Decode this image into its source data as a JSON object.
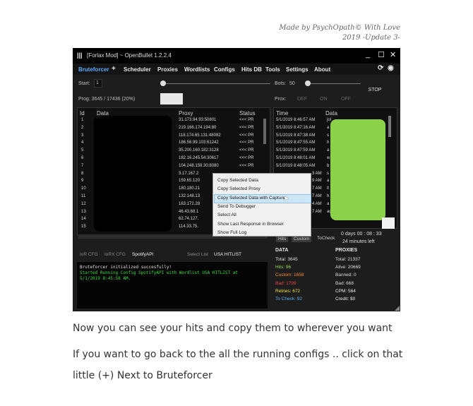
{
  "credit": {
    "line1": "Made by PsychOpath© With Love",
    "line2": "2019 -Update 3-"
  },
  "window": {
    "title": "[Forlax Mod] ~ OpenBullet 1.2.2.4",
    "controls": {
      "minimize": "_",
      "maximize": "☐",
      "close": "✕"
    }
  },
  "menu": {
    "items": [
      "Bruteforcer",
      "+",
      "Scheduler",
      "Proxies",
      "Wordlists",
      "Configs",
      "Hits DB",
      "Tools",
      "Settings",
      "About"
    ],
    "active": "Bruteforcer"
  },
  "controls": {
    "start_label": "Start:",
    "start_value": "1",
    "bots_label": "Bots:",
    "bots_value": "50",
    "stop_button": "STOP",
    "prog_label": "Prog: 3645 / 17436 (20%)",
    "prox_label": "Prox:",
    "prox_options": [
      "DEF",
      "ON",
      "OFF"
    ]
  },
  "grid_left": {
    "headers": [
      "Id",
      "Data",
      "Proxy",
      "Status"
    ],
    "rows": [
      {
        "id": "1",
        "proxy": "31.173.94.93:50801",
        "status": "<<< PR"
      },
      {
        "id": "2",
        "proxy": "219.166.174.194:80",
        "status": "<<< PR"
      },
      {
        "id": "3",
        "proxy": "118.174.65.131:48082",
        "status": "<<< PR"
      },
      {
        "id": "4",
        "proxy": "186.56.99.103:61242",
        "status": "<<< PR"
      },
      {
        "id": "5",
        "proxy": "35.200.160.182:3128",
        "status": "<<< PR"
      },
      {
        "id": "6",
        "proxy": "182.16.245.54:30617",
        "status": "<<< PR"
      },
      {
        "id": "7",
        "proxy": "104.248.159.30:8080",
        "status": "<<< PR"
      },
      {
        "id": "8",
        "proxy": "3.17.167.2",
        "status": ""
      },
      {
        "id": "9",
        "proxy": "159.65.120",
        "status": ""
      },
      {
        "id": "10",
        "proxy": "180.180.21",
        "status": ""
      },
      {
        "id": "11",
        "proxy": "132.148.13",
        "status": ""
      },
      {
        "id": "12",
        "proxy": "163.172.28",
        "status": ""
      },
      {
        "id": "13",
        "proxy": "46.43.68.1",
        "status": ""
      },
      {
        "id": "14",
        "proxy": "62.74.127.",
        "status": ""
      },
      {
        "id": "15",
        "proxy": "114.33.75.",
        "status": ""
      }
    ]
  },
  "grid_right": {
    "headers": [
      "Time",
      "Data"
    ],
    "rows": [
      {
        "time": "5/1/2019 8:46:57 AM",
        "data": "jol"
      },
      {
        "time": "5/1/2019 8:47:16 AM",
        "data": "a"
      },
      {
        "time": "5/1/2019 8:47:38 AM",
        "data": "s"
      },
      {
        "time": "5/1/2019 8:47:55 AM",
        "data": "h"
      },
      {
        "time": "5/1/2019 8:47:59 AM",
        "data": "a"
      },
      {
        "time": "5/1/2019 8:48:01 AM",
        "data": "w"
      },
      {
        "time": "5/1/2019 8:48:05 AM",
        "data": "b"
      },
      {
        "time": "3 AM",
        "data": "s"
      },
      {
        "time": "9 AM",
        "data": "a"
      },
      {
        "time": "7 AM",
        "data": "lt"
      },
      {
        "time": "7 AM",
        "data": "h"
      },
      {
        "time": "4 AM",
        "data": "a"
      },
      {
        "time": "7 AM",
        "data": "ad"
      }
    ]
  },
  "context_menu": {
    "items": [
      "Copy Selected Data",
      "Copy Selected Proxy",
      "Copy Selected Data with Capture",
      "Send To Debugger",
      "Select All",
      "Show Last Response in Browser",
      "Show Full Log"
    ],
    "highlighted_index": 2
  },
  "result_tabs": [
    "Hits",
    "Custom",
    "ToCheck"
  ],
  "timer": {
    "line1": "0 days 00 : 08 : 33",
    "line2": "24 minutes left"
  },
  "config_tabs": [
    "IoR CFG",
    "IoRX CFG",
    "SpotifyAPI",
    "Select List",
    "USA HITLIST"
  ],
  "console": {
    "lines": [
      {
        "text": "Bruteforcer initialized succesfully!",
        "color": "#e0e0e0"
      },
      {
        "text": "Started Running Config SpotifyAPI with Wordlist USA HITLIST at",
        "color": "#3ddc3d"
      },
      {
        "text": "5/1/2019 8:45:58 AM.",
        "color": "#3ddc3d"
      }
    ]
  },
  "stats_data": {
    "heading": "DATA",
    "items": [
      {
        "text": "Total:  3645",
        "color": "#d8d8d8"
      },
      {
        "text": "Hits:  96",
        "color": "#8fe04a"
      },
      {
        "text": "Custom:  1658",
        "color": "#f08a2a"
      },
      {
        "text": "Bad:  1799",
        "color": "#f04040"
      },
      {
        "text": "Retries:  672",
        "color": "#f0e040"
      },
      {
        "text": "To Check:  92",
        "color": "#5ab0ff"
      }
    ]
  },
  "stats_proxies": {
    "heading": "PROXIES",
    "items": [
      {
        "text": "Total:  21337",
        "color": "#d8d8d8"
      },
      {
        "text": "Alive:  20669",
        "color": "#d8d8d8"
      },
      {
        "text": "Banned:  0",
        "color": "#d8d8d8"
      },
      {
        "text": "Bad:  668",
        "color": "#d8d8d8"
      },
      {
        "text": "CPM:  564",
        "color": "#e8e8e8"
      },
      {
        "text": "Credit:  $0",
        "color": "#e8e8e8"
      }
    ]
  },
  "paragraphs": [
    "Now you can see your hits and copy them to wherever you want",
    "If you want to go back to the all the running configs .. click on that",
    "little (+) Next to Bruteforcer"
  ],
  "colors": {
    "redact_black": "#000000",
    "redact_green": "#8cd14a",
    "accent_blue": "#5aa9ff"
  }
}
